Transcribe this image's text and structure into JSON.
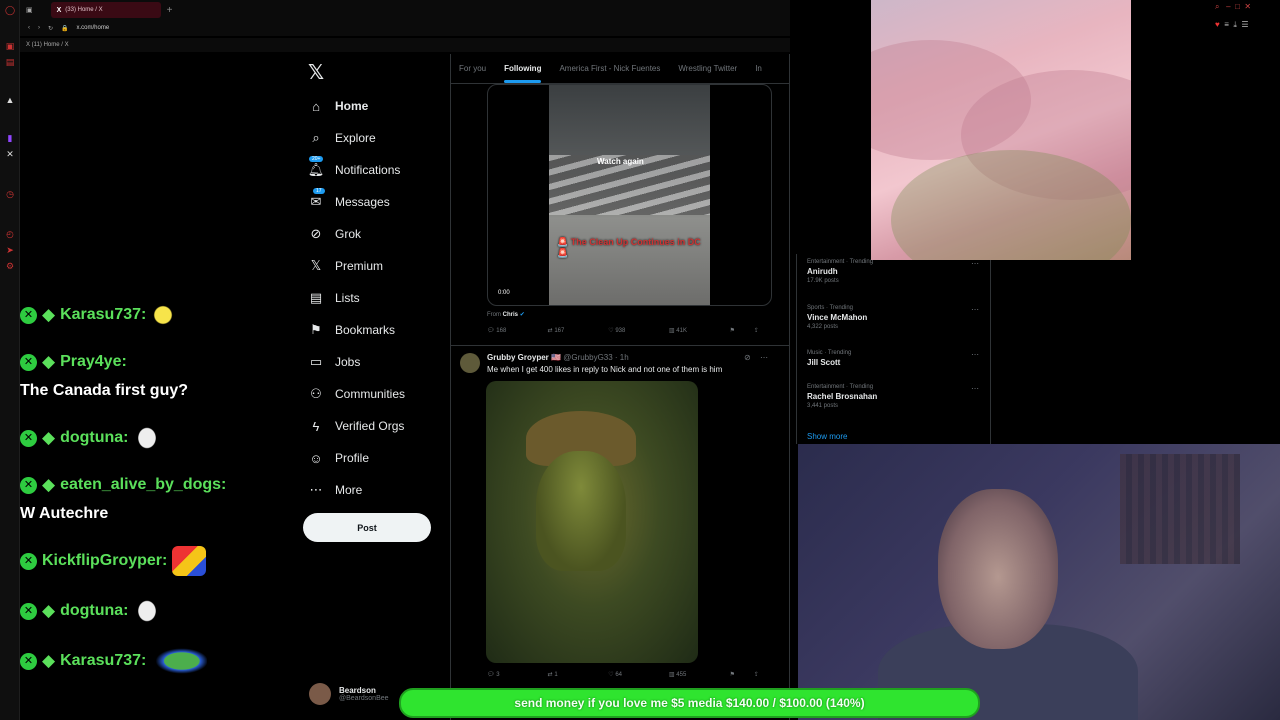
{
  "browser": {
    "tab_title": "(33) Home / X",
    "url": "x.com/home",
    "bookmark_label": "(11) Home / X"
  },
  "chat": [
    {
      "user": "Karasu737:",
      "message": "",
      "emote": "bird-emote"
    },
    {
      "user": "Pray4ye:",
      "message": "The Canada first guy?",
      "emote": ""
    },
    {
      "user": "dogtuna:",
      "message": "",
      "emote": "ghost-emote"
    },
    {
      "user": "eaten_alive_by_dogs:",
      "message": "W Autechre",
      "emote": ""
    },
    {
      "user": "KickflipGroyper:",
      "message": "",
      "emote": "mario-emote"
    },
    {
      "user": "dogtuna:",
      "message": "",
      "emote": "ghost-emote"
    },
    {
      "user": "Karasu737:",
      "message": "",
      "emote": "pepe-emote"
    }
  ],
  "nav": {
    "items": [
      {
        "label": "Home",
        "icon": "home-icon"
      },
      {
        "label": "Explore",
        "icon": "search-icon"
      },
      {
        "label": "Notifications",
        "icon": "bell-icon",
        "badge": "20+"
      },
      {
        "label": "Messages",
        "icon": "mail-icon",
        "badge": "17"
      },
      {
        "label": "Grok",
        "icon": "grok-icon"
      },
      {
        "label": "Premium",
        "icon": "x-icon"
      },
      {
        "label": "Lists",
        "icon": "list-icon"
      },
      {
        "label": "Bookmarks",
        "icon": "bookmark-icon"
      },
      {
        "label": "Jobs",
        "icon": "briefcase-icon"
      },
      {
        "label": "Communities",
        "icon": "people-icon"
      },
      {
        "label": "Verified Orgs",
        "icon": "lightning-icon"
      },
      {
        "label": "Profile",
        "icon": "person-icon"
      },
      {
        "label": "More",
        "icon": "more-icon"
      }
    ],
    "post_label": "Post"
  },
  "account": {
    "name": "Beardson",
    "handle": "@BeardsonBee"
  },
  "feed": {
    "tabs": [
      "For you",
      "Following",
      "America First - Nick Fuentes",
      "Wrestling Twitter",
      "In"
    ],
    "tweet1": {
      "watch_again": "Watch again",
      "caption": "🚨 The Clean Up Continues in DC 🚨",
      "time": "0:00",
      "from_label": "From",
      "from_name": "Chris",
      "replies": "168",
      "reposts": "167",
      "likes": "938",
      "views": "41K"
    },
    "tweet2": {
      "name": "Grubby Groyper 🇺🇸",
      "handle": "@GrubbyG33 · 1h",
      "text": "Me when I get 400 likes in reply to Nick and not one of them is him",
      "replies": "3",
      "reposts": "1",
      "likes": "64",
      "views": "455"
    }
  },
  "trends": [
    {
      "category": "Entertainment · Trending",
      "name": "Anirudh",
      "count": "17.9K posts"
    },
    {
      "category": "Sports · Trending",
      "name": "Vince McMahon",
      "count": "4,322 posts"
    },
    {
      "category": "Music · Trending",
      "name": "Jill Scott",
      "count": ""
    },
    {
      "category": "Entertainment · Trending",
      "name": "Rachel Brosnahan",
      "count": "3,441 posts"
    }
  ],
  "show_more": "Show more",
  "donation": {
    "text": "send money if you love me $5 media $140.00 / $100.00 (140%)"
  },
  "colors": {
    "accent": "#1d9bf0",
    "chat_green": "#5be05b",
    "donation_green": "#2fe42f"
  }
}
